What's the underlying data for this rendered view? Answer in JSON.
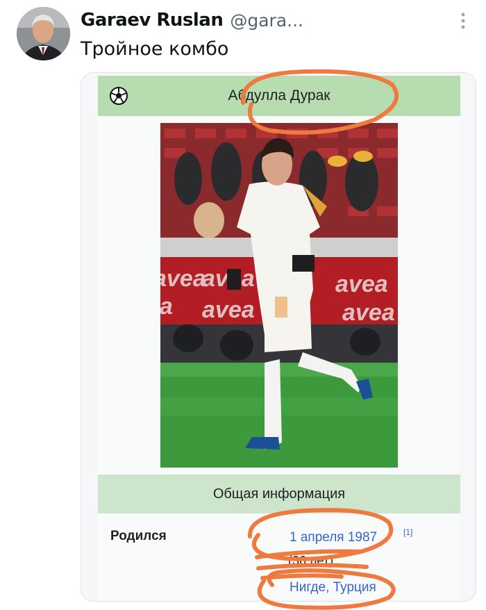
{
  "tweet": {
    "author_name": "Garaev Ruslan",
    "author_handle": "@gara...",
    "text": "Тройное комбо",
    "more_icon": "vertical-dots-icon"
  },
  "infobox": {
    "title": "Абдулла Дурак",
    "header_icon": "soccer-ball-icon",
    "photo_description": "football-player-photo",
    "section_title": "Общая информация",
    "rows": [
      {
        "label": "Родился",
        "date": "1 апреля 1987",
        "ref": "[1]",
        "age": "(36 лет)",
        "place": "Нигде, Турция"
      }
    ]
  },
  "colors": {
    "header_green": "#b6dcb0",
    "section_green": "#cde5cb",
    "link_blue": "#3366cc",
    "scribble_orange": "#ee7a3f"
  }
}
